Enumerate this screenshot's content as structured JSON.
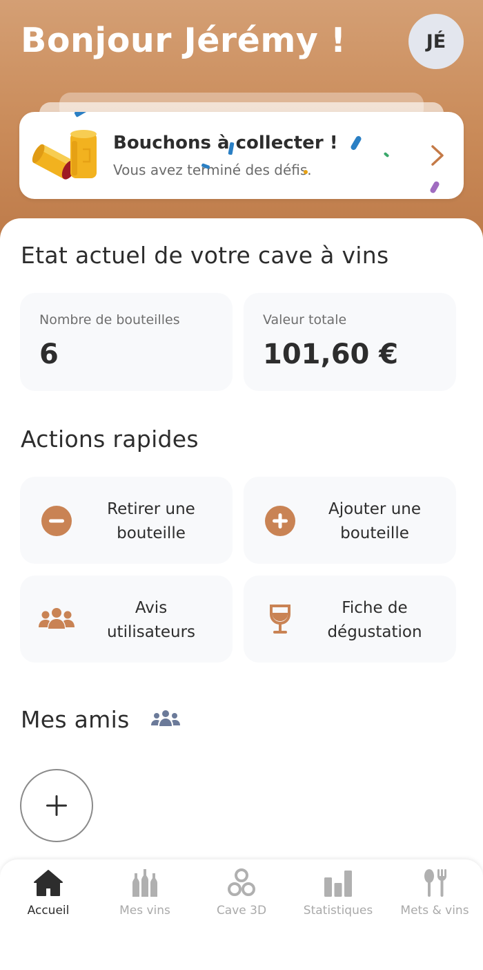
{
  "header": {
    "greeting": "Bonjour Jérémy !",
    "avatar_initials": "JÉ"
  },
  "promo": {
    "title": "Bouchons à collecter !",
    "subtitle": "Vous avez terminé des défis.",
    "icon": "wine-corks-icon",
    "chevron_icon": "chevron-right-icon"
  },
  "cellar": {
    "title": "Etat actuel de votre cave à vins",
    "stats": [
      {
        "label": "Nombre de bouteilles",
        "value": "6"
      },
      {
        "label": "Valeur totale",
        "value": "101,60 €"
      }
    ]
  },
  "quick_actions": {
    "title": "Actions rapides",
    "items": [
      {
        "line1": "Retirer une",
        "line2": "bouteille",
        "icon": "minus-circle-icon"
      },
      {
        "line1": "Ajouter une",
        "line2": "bouteille",
        "icon": "plus-circle-icon"
      },
      {
        "line1": "Avis",
        "line2": "utilisateurs",
        "icon": "users-icon"
      },
      {
        "line1": "Fiche de",
        "line2": "dégustation",
        "icon": "wine-glass-icon"
      }
    ]
  },
  "friends": {
    "title": "Mes amis",
    "icon": "friends-group-icon",
    "add_icon": "plus-icon"
  },
  "tabbar": {
    "items": [
      {
        "label": "Accueil",
        "icon": "home-icon",
        "active": true
      },
      {
        "label": "Mes vins",
        "icon": "bottles-icon",
        "active": false
      },
      {
        "label": "Cave 3D",
        "icon": "cellar-3d-icon",
        "active": false
      },
      {
        "label": "Statistiques",
        "icon": "bar-chart-icon",
        "active": false
      },
      {
        "label": "Mets & vins",
        "icon": "utensils-icon",
        "active": false
      }
    ]
  },
  "colors": {
    "accent": "#c98354",
    "header_top": "#d49f74",
    "header_bottom": "#bd7a49",
    "card_bg": "#f8f9fb",
    "tab_inactive": "#a9a9a9",
    "tab_active": "#2d2d2d"
  }
}
